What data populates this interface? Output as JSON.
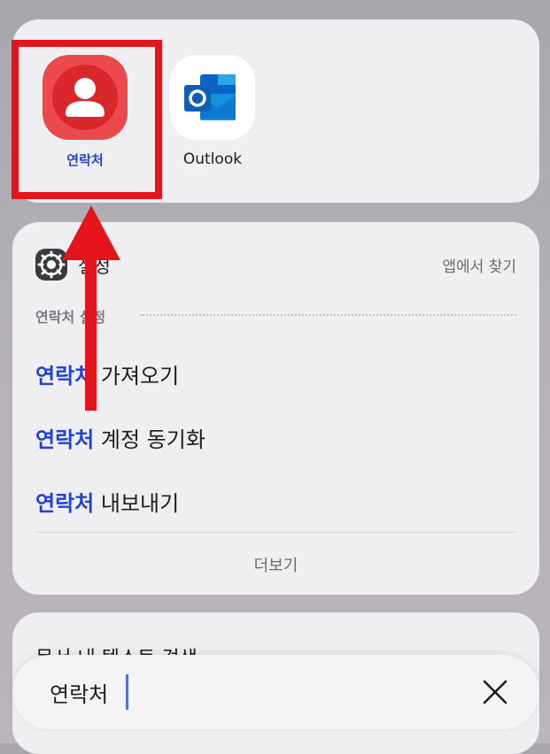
{
  "apps": [
    {
      "label": "연락처",
      "icon": "contacts-person-icon",
      "color": "#e83a3c"
    },
    {
      "label": "Outlook",
      "icon": "outlook-icon",
      "color": "#0f6cbd"
    }
  ],
  "settings": {
    "title": "설정",
    "find_in_app": "앱에서 찾기",
    "section_label": "연락처 설정",
    "results": [
      {
        "highlight": "연락처",
        "rest": " 가져오기"
      },
      {
        "highlight": "연락처",
        "rest": " 계정 동기화"
      },
      {
        "highlight": "연락처",
        "rest": " 내보내기"
      }
    ],
    "more": "더보기"
  },
  "docs": {
    "title": "문서 내 텍스트 검색"
  },
  "search": {
    "value": "연락처"
  },
  "annotation": {
    "highlight_color": "#e5141b"
  }
}
